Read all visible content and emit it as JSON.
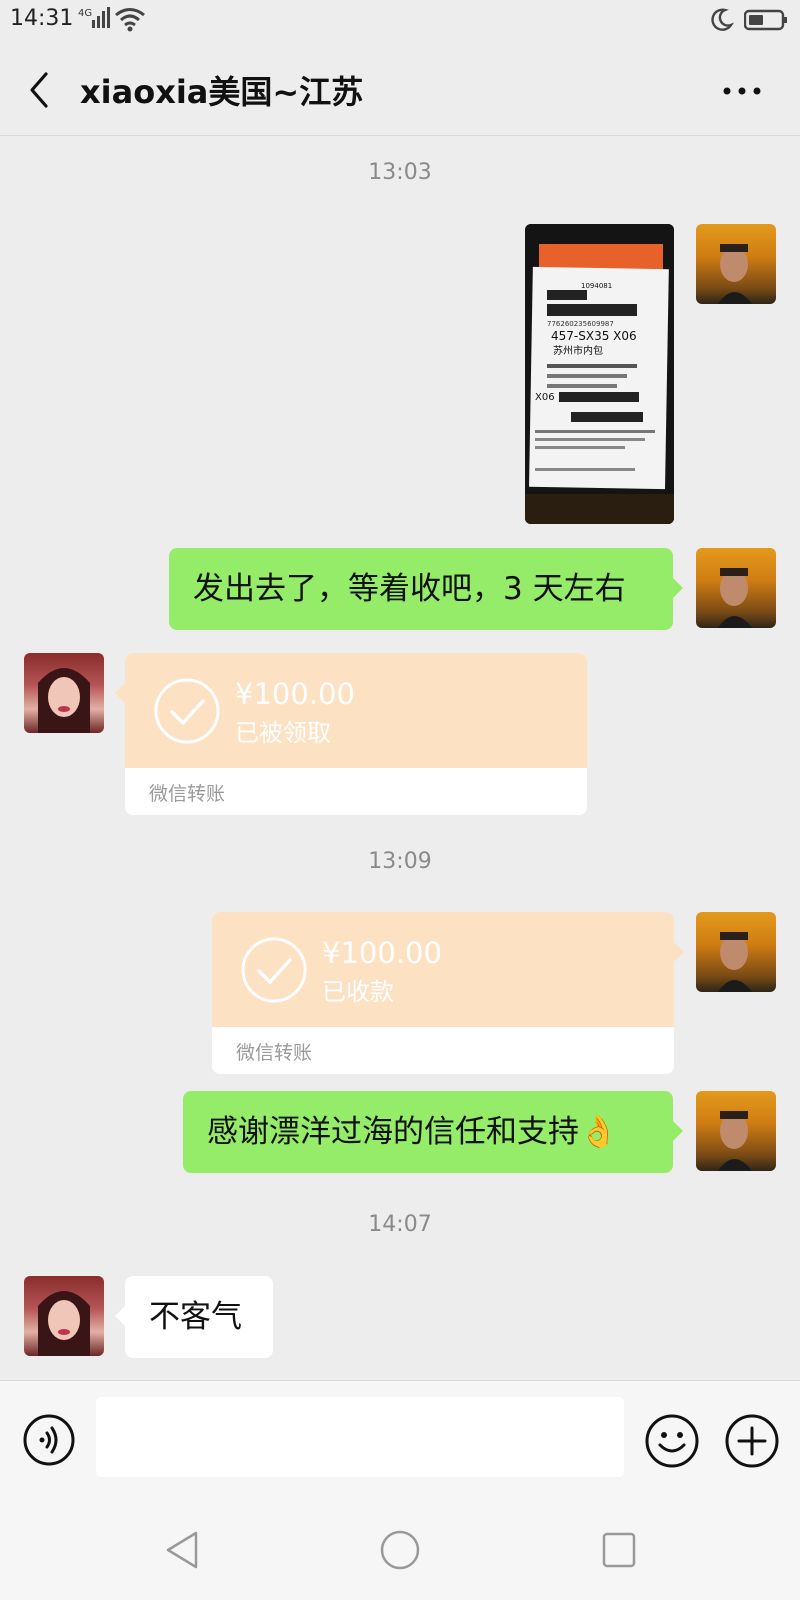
{
  "status_bar": {
    "time": "14:31",
    "network": "4G"
  },
  "header": {
    "title": "xiaoxia美国~江苏"
  },
  "messages": {
    "ts1": "13:03",
    "text1": "发出去了，等着收吧，3 天左右",
    "transfer1": {
      "amount": "¥100.00",
      "status": "已被领取",
      "footer": "微信转账"
    },
    "ts2": "13:09",
    "transfer2": {
      "amount": "¥100.00",
      "status": "已收款",
      "footer": "微信转账"
    },
    "text2": "感谢漂洋过海的信任和支持👌",
    "ts3": "14:07",
    "text3": "不客气"
  },
  "photo": {
    "tracking": "776260235609987",
    "code": "457-SX35 X06",
    "route": "苏州市内包",
    "order_no": "1094081",
    "sort": "X06"
  },
  "colors": {
    "sent_bubble": "#95ec69",
    "transfer": "#fde1c3",
    "background": "#ededed"
  }
}
